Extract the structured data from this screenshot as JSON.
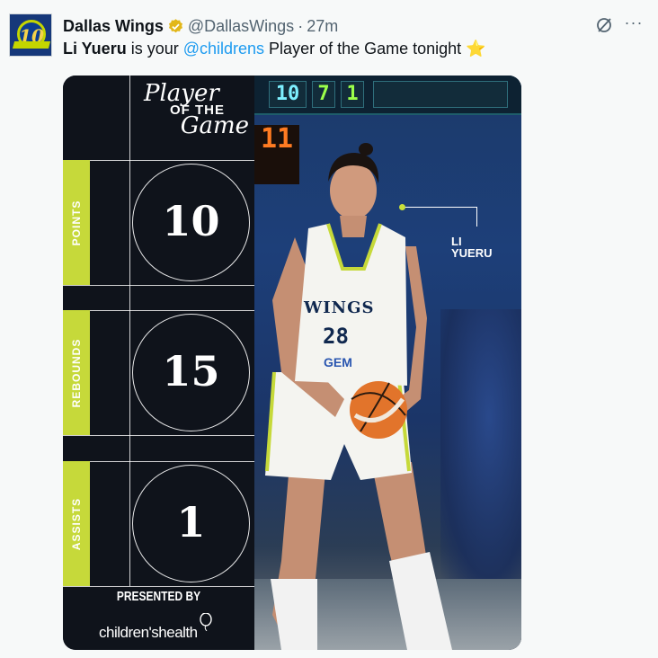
{
  "tweet": {
    "author_name": "Dallas Wings",
    "handle": "@DallasWings",
    "separator": "·",
    "time": "27m",
    "more_label": "···",
    "text_parts": {
      "player": "Li Yueru",
      "middle": " is your ",
      "mention": "@childrens",
      "end": " Player of the Game tonight "
    },
    "emoji": "⭐"
  },
  "graphic": {
    "title_line1": "Player",
    "title_line2": "OF THE",
    "title_line3": "Game",
    "stats": [
      {
        "label": "POINTS",
        "value": "10"
      },
      {
        "label": "REBOUNDS",
        "value": "15"
      },
      {
        "label": "ASSISTS",
        "value": "1"
      }
    ],
    "presented_by": "PRESENTED BY",
    "sponsor": "children'shealth",
    "player_label_line1": "LI",
    "player_label_line2": "YUERU",
    "jersey_team": "WINGS",
    "jersey_number": "28",
    "jersey_sponsor": "GEM",
    "scoreboard_digits": [
      "10",
      "7",
      "1"
    ],
    "shot_clock": "11",
    "accent_color": "#c6d93a"
  }
}
